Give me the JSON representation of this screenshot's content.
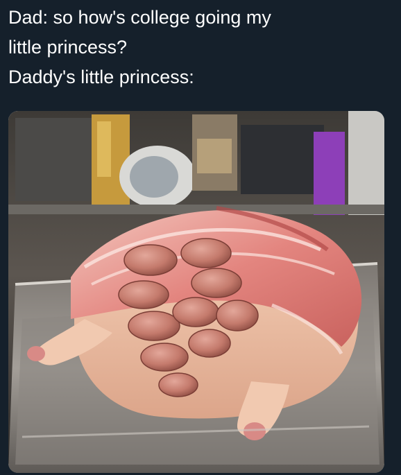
{
  "caption": {
    "line1": "Dad: so how's college going my",
    "line2": "little princess?",
    "line3": "Daddy's little princess:"
  },
  "photo": {
    "subject_icon": "meat-sculpture-photo"
  },
  "colors": {
    "background": "#15202b",
    "text": "#ffffff"
  }
}
